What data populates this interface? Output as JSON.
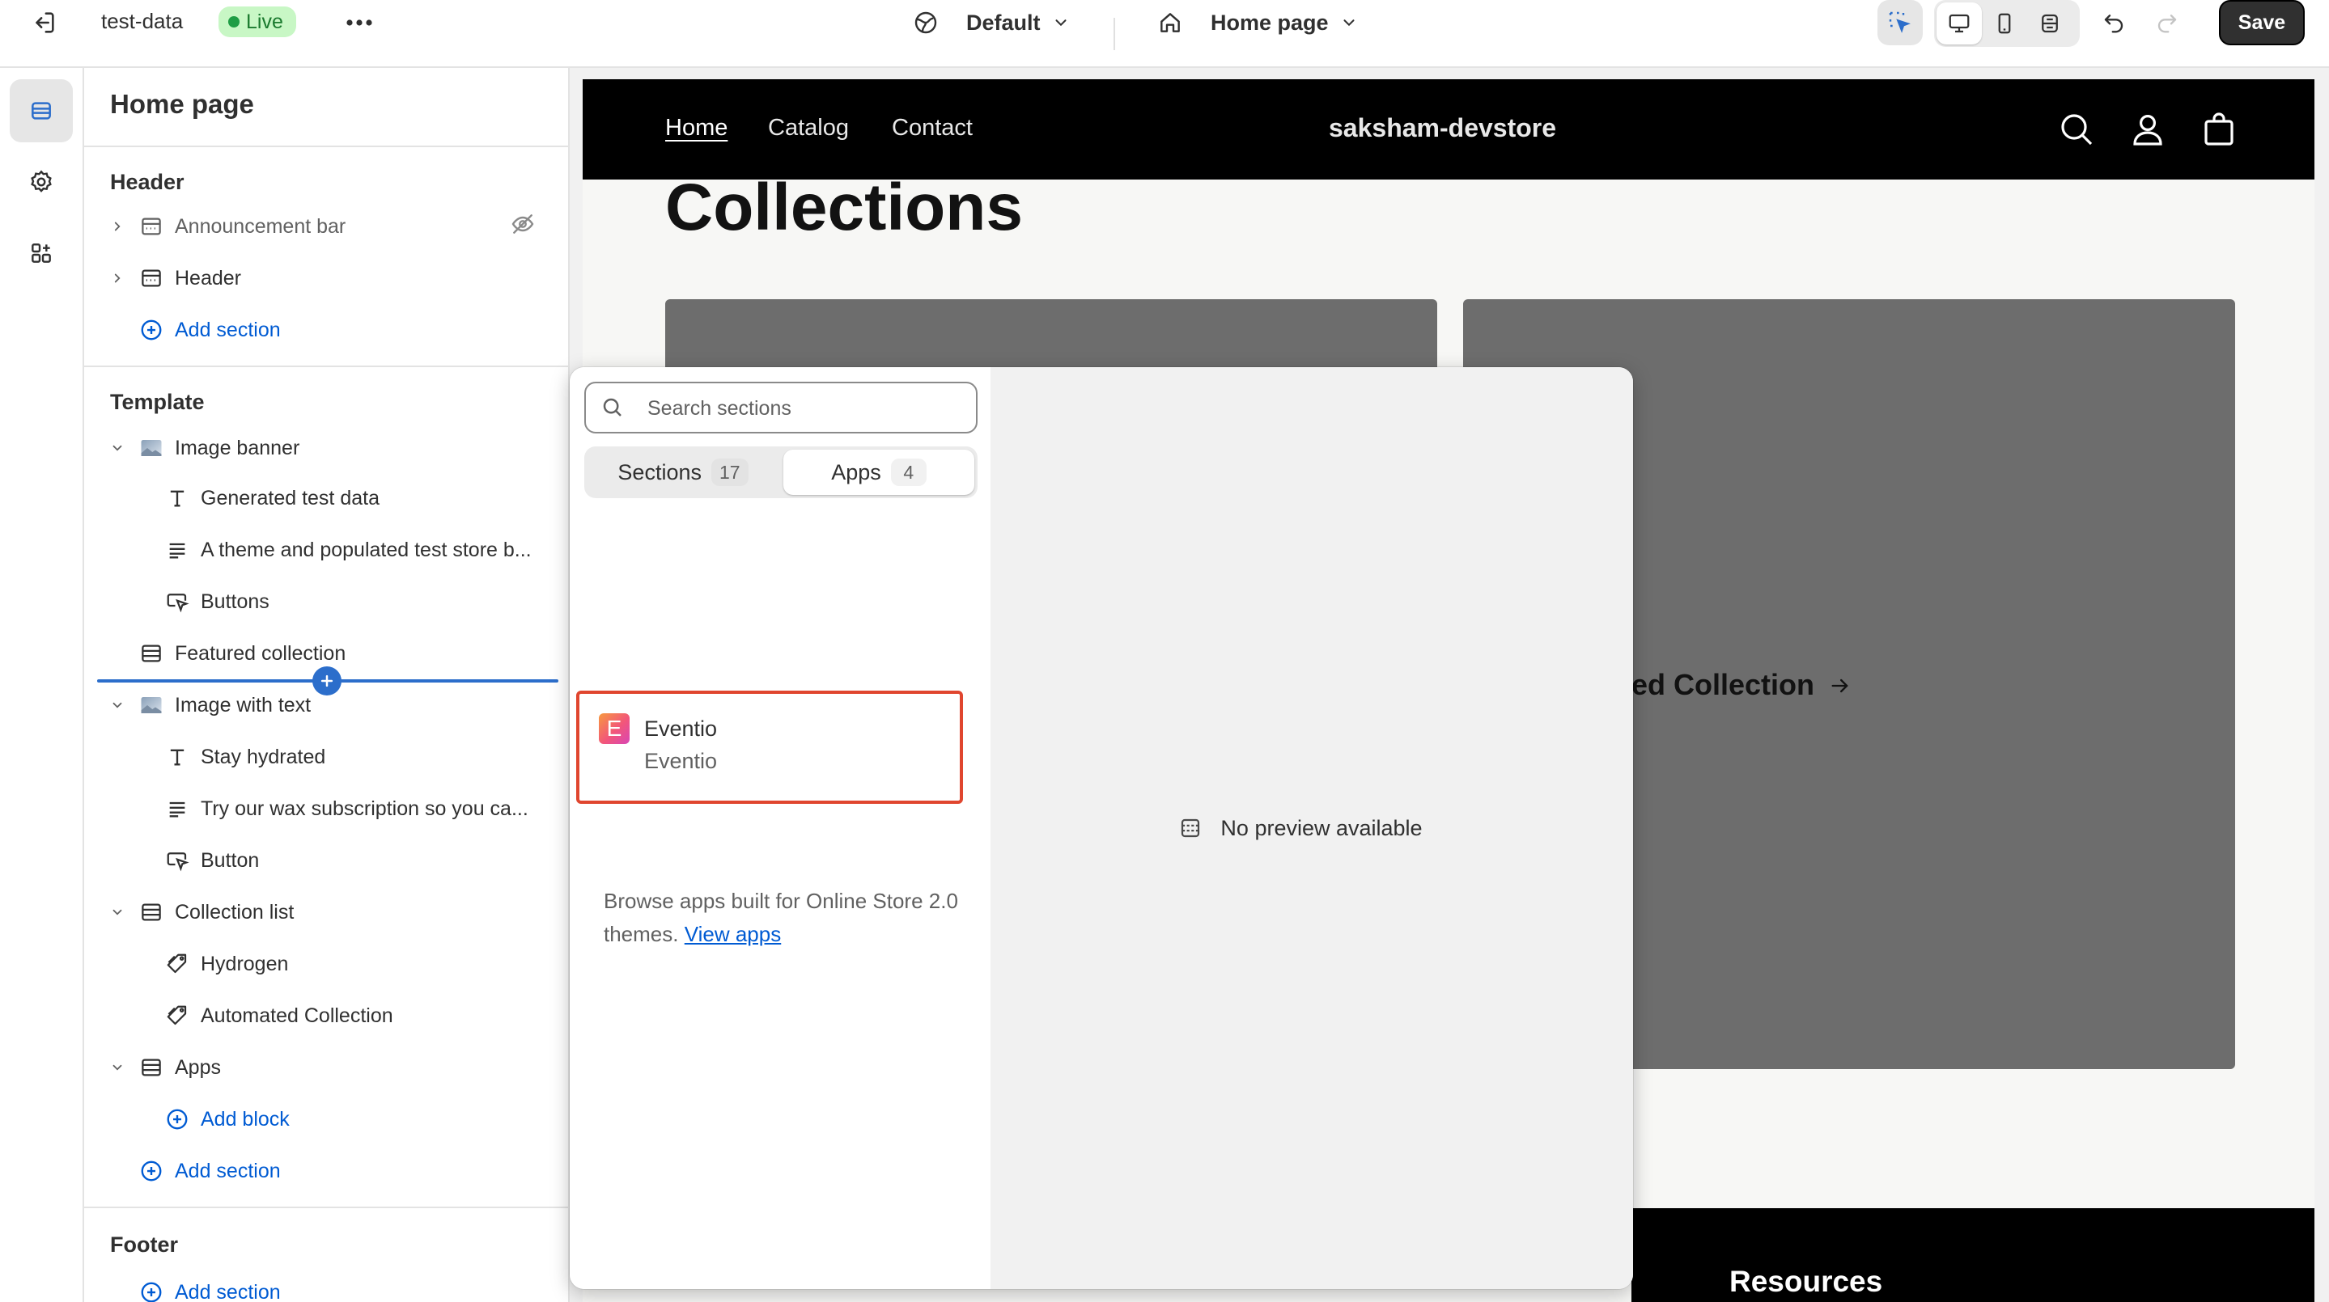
{
  "topbar": {
    "store_name": "test-data",
    "status_badge": "Live",
    "theme_dropdown": "Default",
    "page_dropdown": "Home page",
    "save_label": "Save"
  },
  "sidebar": {
    "title": "Home page",
    "header_group": {
      "heading": "Header",
      "items": [
        {
          "label": "Announcement bar",
          "hidden": true
        },
        {
          "label": "Header"
        }
      ],
      "add_section": "Add section"
    },
    "template_group": {
      "heading": "Template",
      "image_banner": {
        "label": "Image banner",
        "blocks": [
          "Generated test data",
          "A theme and populated test store b...",
          "Buttons"
        ]
      },
      "featured_collection": "Featured collection",
      "image_with_text": {
        "label": "Image with text",
        "blocks": [
          "Stay hydrated",
          "Try our wax subscription so you ca...",
          "Button"
        ]
      },
      "collection_list": {
        "label": "Collection list",
        "blocks": [
          "Hydrogen",
          "Automated Collection"
        ]
      },
      "apps": {
        "label": "Apps",
        "add_block": "Add block"
      },
      "add_section": "Add section"
    },
    "footer_group": {
      "heading": "Footer",
      "add_section": "Add section"
    }
  },
  "preview": {
    "nav": [
      "Home",
      "Catalog",
      "Contact"
    ],
    "store_logo": "saksham-devstore",
    "page_heading": "Collections",
    "card_label": "ed Collection",
    "footer_heading": "Resources"
  },
  "popover": {
    "search_placeholder": "Search sections",
    "tabs": [
      {
        "label": "Sections",
        "count": "17",
        "active": false
      },
      {
        "label": "Apps",
        "count": "4",
        "active": true
      }
    ],
    "app_item": {
      "name": "Eventio",
      "subtitle": "Eventio",
      "logo_letter": "E"
    },
    "browse_text": "Browse apps built for Online Store 2.0 themes.",
    "browse_link": "View apps",
    "no_preview": "No preview available"
  },
  "colors": {
    "accent_blue": "#005bd3",
    "insert_line": "#2c6ecb",
    "live_badge_bg": "#c8f7c5",
    "highlight_border": "#e0462f"
  }
}
